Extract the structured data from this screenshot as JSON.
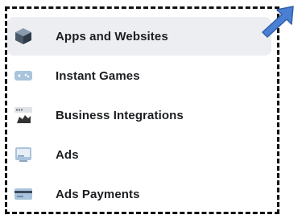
{
  "menu": {
    "items": [
      {
        "label": "Apps and Websites",
        "icon": "apps-cube-icon",
        "active": true
      },
      {
        "label": "Instant Games",
        "icon": "game-controller-icon",
        "active": false
      },
      {
        "label": "Business Integrations",
        "icon": "business-integration-icon",
        "active": false
      },
      {
        "label": "Ads",
        "icon": "ads-icon",
        "active": false
      },
      {
        "label": "Ads Payments",
        "icon": "ads-payments-icon",
        "active": false
      }
    ]
  },
  "annotation": {
    "arrow_color": "#4a7fd4",
    "border_color": "#111111"
  },
  "colors": {
    "active_bg": "#edeef1",
    "text": "#1c1e21"
  }
}
